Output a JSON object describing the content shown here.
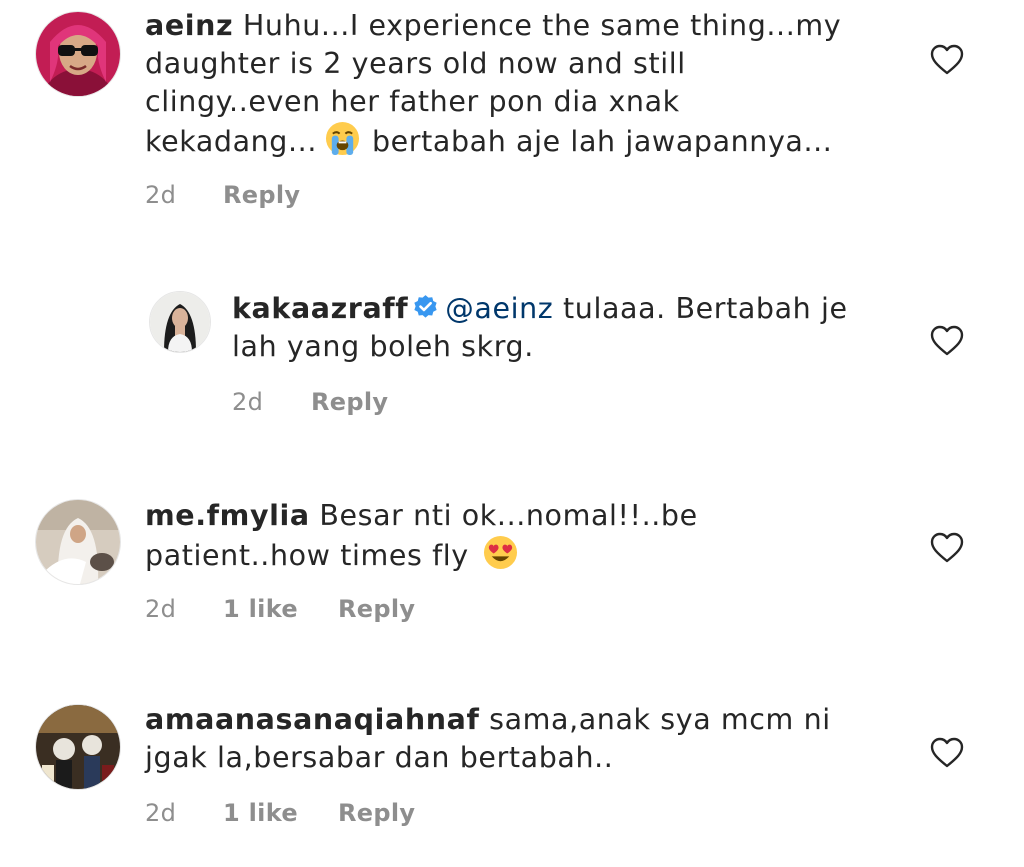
{
  "comments": [
    {
      "username": "aeinz",
      "text_line1": "Huhu...I experience the same thing...my",
      "text_line2": "daughter is 2 years old now and still",
      "text_line3": "clingy..even her father pon dia xnak",
      "text_line4a": "kekadang...",
      "text_line4b": "bertabah aje lah jawapannya...",
      "emoji": "loudly-crying-face",
      "time": "2d",
      "reply_label": "Reply"
    },
    {
      "username": "kakaazraff",
      "verified": true,
      "mention": "@aeinz",
      "text_line1": "tulaaa. Bertabah je",
      "text_line2": "lah yang boleh skrg.",
      "time": "2d",
      "reply_label": "Reply"
    },
    {
      "username": "me.fmylia",
      "text_line1": "Besar nti ok...nomal!!..be",
      "text_line2": "patient..how times fly",
      "emoji": "smiling-face-with-heart-eyes",
      "time": "2d",
      "likes": "1 like",
      "reply_label": "Reply"
    },
    {
      "username": "amaanasanaqiahnaf",
      "text_line1": "sama,anak sya mcm ni",
      "text_line2": "jgak la,bersabar dan bertabah..",
      "time": "2d",
      "likes": "1 like",
      "reply_label": "Reply"
    }
  ],
  "icons": {
    "like": "heart-outline-icon",
    "verified": "verified-badge-icon"
  },
  "colors": {
    "text": "#262626",
    "meta": "#8e8e8e",
    "mention": "#00376b",
    "verified": "#3897f0"
  }
}
